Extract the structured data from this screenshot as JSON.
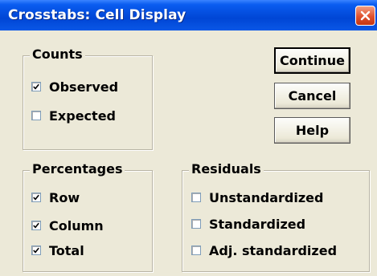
{
  "window": {
    "title": "Crosstabs: Cell Display"
  },
  "counts": {
    "legend": "Counts",
    "items": [
      {
        "label": "Observed",
        "checked": true
      },
      {
        "label": "Expected",
        "checked": false
      }
    ]
  },
  "percentages": {
    "legend": "Percentages",
    "items": [
      {
        "label": "Row",
        "checked": true
      },
      {
        "label": "Column",
        "checked": true
      },
      {
        "label": "Total",
        "checked": true
      }
    ]
  },
  "residuals": {
    "legend": "Residuals",
    "items": [
      {
        "label": "Unstandardized",
        "checked": false
      },
      {
        "label": "Standardized",
        "checked": false
      },
      {
        "label": "Adj. standardized",
        "checked": false
      }
    ]
  },
  "buttons": {
    "continue_label": "Continue",
    "cancel_label": "Cancel",
    "help_label": "Help"
  },
  "icons": {
    "close": "close-icon",
    "check": "checkmark-icon"
  },
  "colors": {
    "titlebar": "#0046d5",
    "dialog_bg": "#ece9d8",
    "close_button": "#e0512e"
  }
}
